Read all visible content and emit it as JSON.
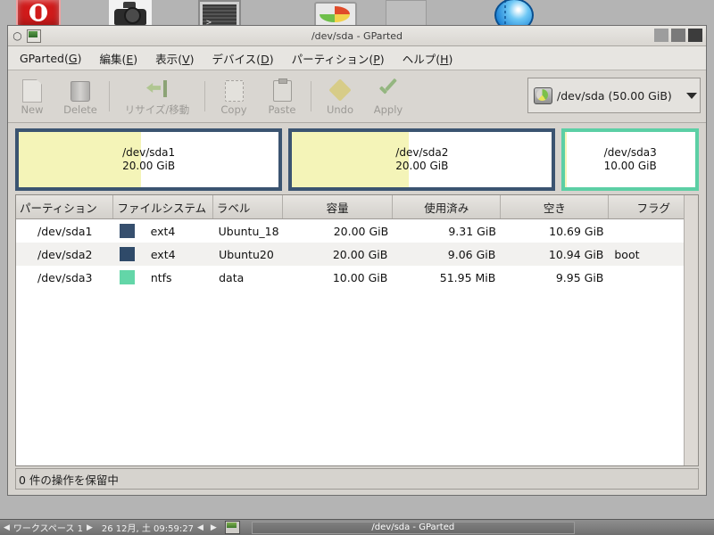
{
  "desktop": {
    "icons": [
      {
        "name": "power-icon",
        "label": "shutdown"
      },
      {
        "name": "camera-icon",
        "label": "screenshot"
      },
      {
        "name": "terminal-icon",
        "label": "terminal"
      },
      {
        "name": "disk-utility-icon",
        "label": "gparted"
      },
      {
        "name": "blank-window-icon",
        "label": "files"
      },
      {
        "name": "globe-icon",
        "label": "browser"
      }
    ]
  },
  "window": {
    "title": "/dev/sda - GParted",
    "controls": {
      "minimize": "minimize",
      "maximize": "maximize",
      "close": "close"
    }
  },
  "menubar": [
    {
      "label": "GParted(G)",
      "text": "GParted",
      "accel": "G"
    },
    {
      "label": "編集(E)",
      "text": "編集",
      "accel": "E"
    },
    {
      "label": "表示(V)",
      "text": "表示",
      "accel": "V"
    },
    {
      "label": "デバイス(D)",
      "text": "デバイス",
      "accel": "D"
    },
    {
      "label": "パーティション(P)",
      "text": "パーティション",
      "accel": "P"
    },
    {
      "label": "ヘルプ(H)",
      "text": "ヘルプ",
      "accel": "H"
    }
  ],
  "toolbar": {
    "new_label": "New",
    "delete_label": "Delete",
    "resize_label": "リサイズ/移動",
    "copy_label": "Copy",
    "paste_label": "Paste",
    "undo_label": "Undo",
    "apply_label": "Apply"
  },
  "device_selector": {
    "value": "/dev/sda  (50.00 GiB)",
    "device": "/dev/sda",
    "size": "50.00 GiB"
  },
  "partition_graphic": [
    {
      "name": "/dev/sda1",
      "size": "20.00 GiB",
      "used_pct": 47,
      "fs": "ext4",
      "border": "#3b5471",
      "fill": "#f4f4b8"
    },
    {
      "name": "/dev/sda2",
      "size": "20.00 GiB",
      "used_pct": 45,
      "fs": "ext4",
      "border": "#3b5471",
      "fill": "#f4f4b8"
    },
    {
      "name": "/dev/sda3",
      "size": "10.00 GiB",
      "used_pct": 1,
      "fs": "ntfs",
      "border": "#5ccfa5",
      "fill": "#f4f4b8"
    }
  ],
  "table": {
    "headers": [
      "パーティション",
      "ファイルシステム",
      "ラベル",
      "容量",
      "使用済み",
      "空き",
      "フラグ"
    ],
    "rows": [
      {
        "partition": "/dev/sda1",
        "filesystem": "ext4",
        "fs_color": "#364f6e",
        "label": "Ubuntu_18",
        "size": "20.00 GiB",
        "used": "9.31 GiB",
        "free": "10.69 GiB",
        "flags": ""
      },
      {
        "partition": "/dev/sda2",
        "filesystem": "ext4",
        "fs_color": "#2f4a69",
        "label": "Ubuntu20",
        "size": "20.00 GiB",
        "used": "9.06 GiB",
        "free": "10.94 GiB",
        "flags": "boot"
      },
      {
        "partition": "/dev/sda3",
        "filesystem": "ntfs",
        "fs_color": "#63d6a8",
        "label": "data",
        "size": "10.00 GiB",
        "used": "51.95 MiB",
        "free": "9.95 GiB",
        "flags": ""
      }
    ]
  },
  "statusbar": {
    "text": "0 件の操作を保留中"
  },
  "taskbar": {
    "workspace": "ワークスペース 1",
    "clock": "26 12月, 土 09:59:27",
    "window_button": "/dev/sda - GParted",
    "left_arrow": "◀",
    "right_arrow": "▶"
  }
}
